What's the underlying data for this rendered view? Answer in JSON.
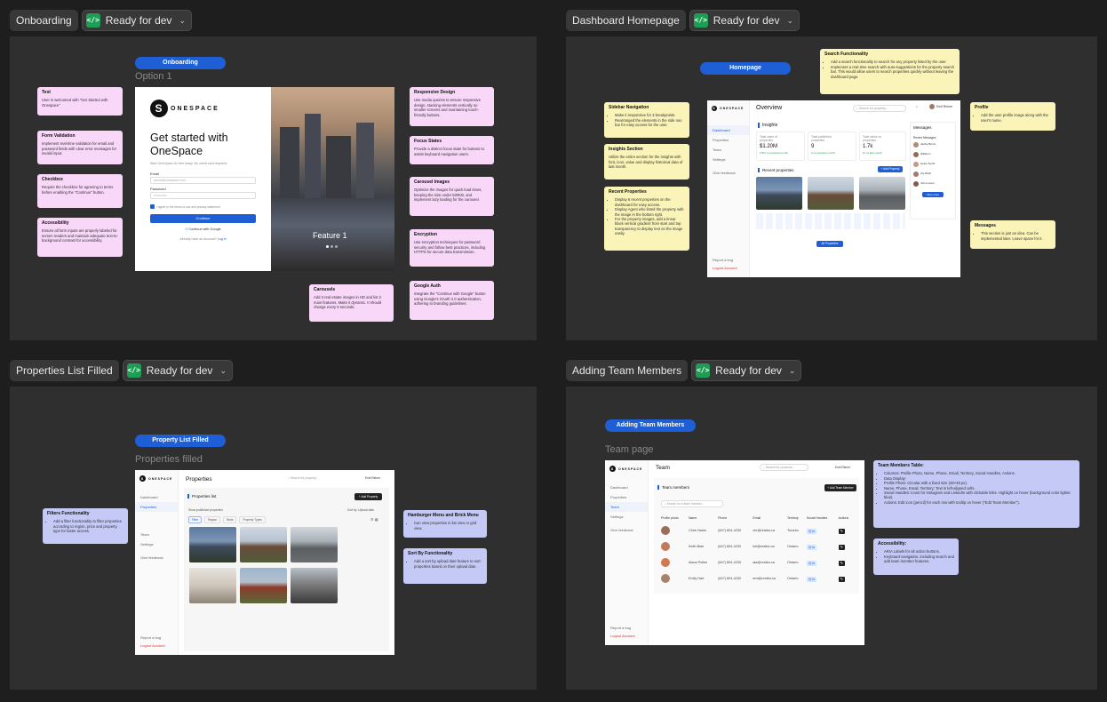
{
  "sections": [
    {
      "title": "Onboarding",
      "status": "Ready for dev"
    },
    {
      "title": "Dashboard Homepage",
      "status": "Ready for dev"
    },
    {
      "title": "Properties List Filled",
      "status": "Ready for dev"
    },
    {
      "title": "Adding Team Members",
      "status": "Ready for dev"
    }
  ],
  "colors": {
    "canvas": "#1e1e1e",
    "panel": "#2f2f2f",
    "badge": "#1e5fd6",
    "pink_note": "#f8d7f8",
    "yellow_note": "#fbf4b8",
    "blue_note": "#c4c9f6",
    "dev_icon": "#1f9d55"
  },
  "onboarding": {
    "badge": "Onboarding",
    "subtitle": "Option 1",
    "brand": "ONESPACE",
    "heading": "Get started with OneSpace",
    "tagline": "Start OneSpace for free today. No credit card required.",
    "email_label": "Email",
    "email_placeholder": "admin@onespace.com",
    "password_label": "Password",
    "password_value": "••••••••••••",
    "terms": "I agree to the terms of use and privacy statement",
    "continue": "Continue",
    "google": "Continue with Google",
    "login_prompt": "Already have an account?",
    "login_link": "Log in",
    "feature": "Feature 1",
    "notes_left": [
      {
        "title": "Text",
        "body": "User is welcomed with \"Get Started with Onespace\""
      },
      {
        "title": "Form Validation",
        "body": "Implement real-time validation for email and password fields with clear error messages for invalid input."
      },
      {
        "title": "Checkbox",
        "body": "Require the checkbox for agreeing to terms before enabling the \"Continue\" button."
      },
      {
        "title": "Accessibility",
        "body": "Ensure all form inputs are properly labeled for screen readers and maintain adequate text-to-background contrast for accessibility."
      }
    ],
    "notes_right": [
      {
        "title": "Responsive Design",
        "body": "Use media queries to ensure responsive design, stacking elements vertically on smaller screens and maintaining touch-friendly buttons."
      },
      {
        "title": "Focus States",
        "body": "Provide a distinct focus state for buttons to assist keyboard navigation users."
      },
      {
        "title": "Carousel Images",
        "body": "Optimize the images for quick load times, keeping the size under 500KB, and implement lazy loading for the carousel."
      },
      {
        "title": "Encryption",
        "body": "Use encryption techniques for password security and follow best practices, including HTTPS for secure data transmission."
      },
      {
        "title": "Google Auth",
        "body": "Integrate the \"Continue with Google\" button using Google's OAuth 2.0 authentication, adhering to branding guidelines."
      }
    ],
    "note_carousels": {
      "title": "Carousels",
      "body": "Add 3 real estate images in HD and list 3 main features. Make it dynamic. It should change every 5 seconds."
    }
  },
  "dashboard": {
    "badge": "Homepage",
    "title": "Overview",
    "search": "Search for property...",
    "user": "Emil Reiner",
    "nav": [
      "Dashboard",
      "Properties",
      "Team",
      "Settings",
      "Give feedback"
    ],
    "bottom_nav": [
      "Report a bug",
      "Logout Account"
    ],
    "insights_title": "Insights",
    "stats": [
      {
        "label": "Total value of properties",
        "value": "$1.20M",
        "delta": "2.8% vs previous month"
      },
      {
        "label": "Total published properties",
        "value": "9",
        "delta": "2 vs previous month"
      },
      {
        "label": "Total views on properties",
        "value": "1.7k",
        "delta": "1k vs last month"
      }
    ],
    "recent_title": "Recent properties",
    "add": "+ Add Property",
    "view_props": "All Properties",
    "messages_title": "Messages",
    "recent_messages": "Recent Messages",
    "view_more": "View more",
    "message_names": [
      "Jackie Burns",
      "William L.",
      "Helen Smith",
      "Lily Bush",
      "John Lorem"
    ],
    "notes": [
      {
        "title": "Search Functionality",
        "items": [
          "Add a search functionality to search for any property listed by the user.",
          "Implement a real-time search with auto-suggestions for the property search bar. This would allow users to search properties quickly without leaving the dashboard page."
        ]
      },
      {
        "title": "Sidebar Navigation",
        "items": [
          "Make it responsive for 3 breakpoints.",
          "Rearranged the elements in the side nav bar for easy access for the user."
        ]
      },
      {
        "title": "Insights Section",
        "body": "Utilize the entire section for the insights with font, icon, value and display historical data of last month."
      },
      {
        "title": "Recent Properties",
        "items": [
          "Display 6 recent properties on the dashboard for easy access.",
          "Display Agent who listed the property with the image in the bottom right.",
          "For the property images, add a linear black vertical gradient from start and top transparency to display text on the image easily."
        ]
      },
      {
        "title": "Profile",
        "items": [
          "Add the user profile image along with the user's name."
        ]
      },
      {
        "title": "Messages",
        "items": [
          "This section is just an idea. Can be implemented later. Leave space for it."
        ]
      }
    ]
  },
  "properties": {
    "badge": "Property List Filled",
    "subtitle": "Properties filled",
    "title": "Properties",
    "search": "Search for property...",
    "user": "Emil Reiner",
    "list_title": "Properties list",
    "add": "+ Add Property",
    "show_only": "Show published properties",
    "sort": "Sort by: Upload date",
    "filters": [
      "Filter",
      "Region",
      "Beds",
      "Property Types"
    ],
    "nav": [
      "Dashboard",
      "Properties",
      "Team",
      "Settings",
      "Give feedback"
    ],
    "bottom_nav": [
      "Report a bug",
      "Logout Account"
    ],
    "notes": [
      {
        "title": "Filters Functionality",
        "items": [
          "Add a filter functionality to filter properties according to region, price and property type for faster access."
        ]
      },
      {
        "title": "Hamburger Menu and Brick Menu",
        "items": [
          "Can view properties in list view or grid view."
        ]
      },
      {
        "title": "Sort By Functionality",
        "items": [
          "Add a sort by upload date feature to sort properties based on their upload date."
        ]
      }
    ]
  },
  "team": {
    "badge": "Adding Team Members",
    "subtitle": "Team page",
    "title": "Team",
    "search": "Search for products...",
    "user": "Emil Reiner",
    "members_title": "Team members",
    "add": "+ Add Team Member",
    "search_member": "Search for a team member...",
    "columns": [
      "Profile photo",
      "Name",
      "Phone",
      "Email",
      "Territory",
      "Social Handles",
      "Actions"
    ],
    "rows": [
      {
        "name": "Chris Harris",
        "phone": "(647) 804-4230",
        "email": "chr@realtor.ca",
        "territory": "Toronto"
      },
      {
        "name": "Keith Blair",
        "phone": "(647) 804-4230",
        "email": "kei@realtor.ca",
        "territory": "Ontario"
      },
      {
        "name": "Alana Pollen",
        "phone": "(647) 804-4230",
        "email": "ala@realtor.ca",
        "territory": "Ontario"
      },
      {
        "name": "Emily Hart",
        "phone": "(647) 804-4230",
        "email": "emi@realtor.ca",
        "territory": "Ontario"
      }
    ],
    "nav": [
      "Dashboard",
      "Properties",
      "Team",
      "Settings",
      "Give feedback"
    ],
    "bottom_nav": [
      "Report a bug",
      "Logout Account"
    ],
    "notes": [
      {
        "title": "Team Members Table:",
        "items": [
          "Columns: Profile Photo, Name, Phone, Email, Territory, Social Handles, Actions.",
          "Data Display:",
          "Profile Photo: Circular with a fixed size (48×48 px).",
          "Name, Phone, Email, Territory: Text in left-aligned cells.",
          "Social Handles: Icons for Instagram and LinkedIn with clickable links. Highlight on hover (background color lighter blue).",
          "Actions: Edit icon (pencil) for each row with tooltip on hover (\"Edit Team Member\")."
        ]
      },
      {
        "title": "Accessibility:",
        "items": [
          "ARIA Labels for all action buttons.",
          "Keyboard navigation, including search and add team member features."
        ]
      }
    ]
  }
}
